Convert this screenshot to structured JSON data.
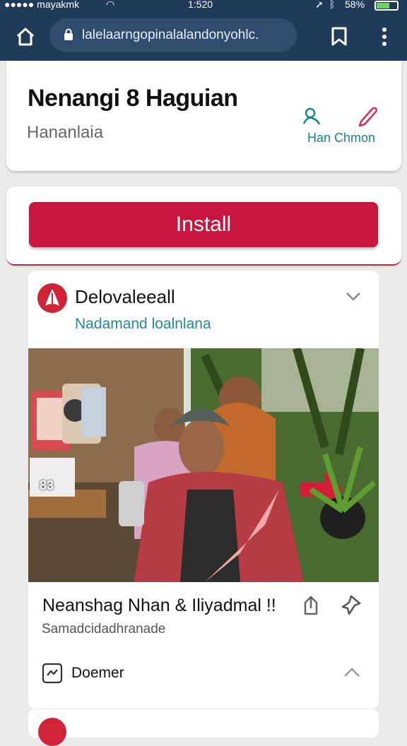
{
  "status": {
    "carrier": "●●●●● mayakmk",
    "time": "1:520",
    "battery": "58%"
  },
  "browser": {
    "url": "lalelaarngopinalalandonyohlc."
  },
  "header": {
    "title": "Nenangi 8 Haguian",
    "subtitle": "Hananlaia",
    "action_label": "Han Chmon",
    "accent": "#18858c"
  },
  "install": {
    "label": "Install",
    "color": "#c8163f"
  },
  "post": {
    "author": "Delovaleeall",
    "tagline": "Nadamand loalnlana",
    "image_badge": "83",
    "title": "Neanshag Nhan & Iliyadmal !!",
    "description": "Samadcidadhranade",
    "comment_label": "Doemer"
  }
}
